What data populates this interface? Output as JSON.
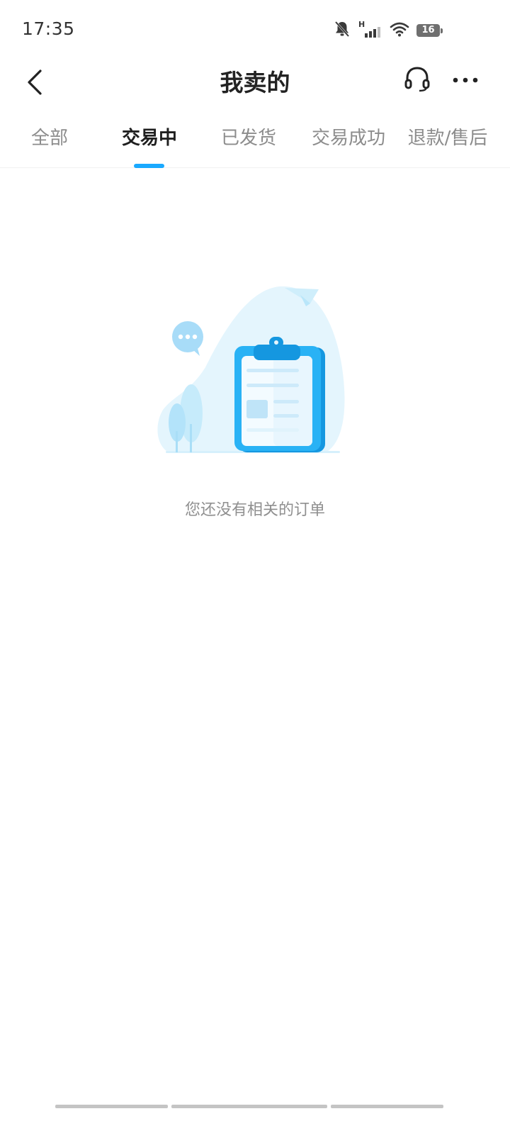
{
  "status_bar": {
    "time": "17:35",
    "network_label": "H",
    "battery_level": "16"
  },
  "header": {
    "title": "我卖的"
  },
  "tabs": [
    {
      "label": "全部",
      "active": false
    },
    {
      "label": "交易中",
      "active": true
    },
    {
      "label": "已发货",
      "active": false
    },
    {
      "label": "交易成功",
      "active": false
    },
    {
      "label": "退款/售后",
      "active": false
    }
  ],
  "empty_state": {
    "message": "您还没有相关的订单",
    "illustration": "clipboard-illustration"
  },
  "colors": {
    "accent": "#1aa9ff",
    "illustration_light": "#e4f5fd",
    "illustration_blue": "#29b2f5"
  }
}
